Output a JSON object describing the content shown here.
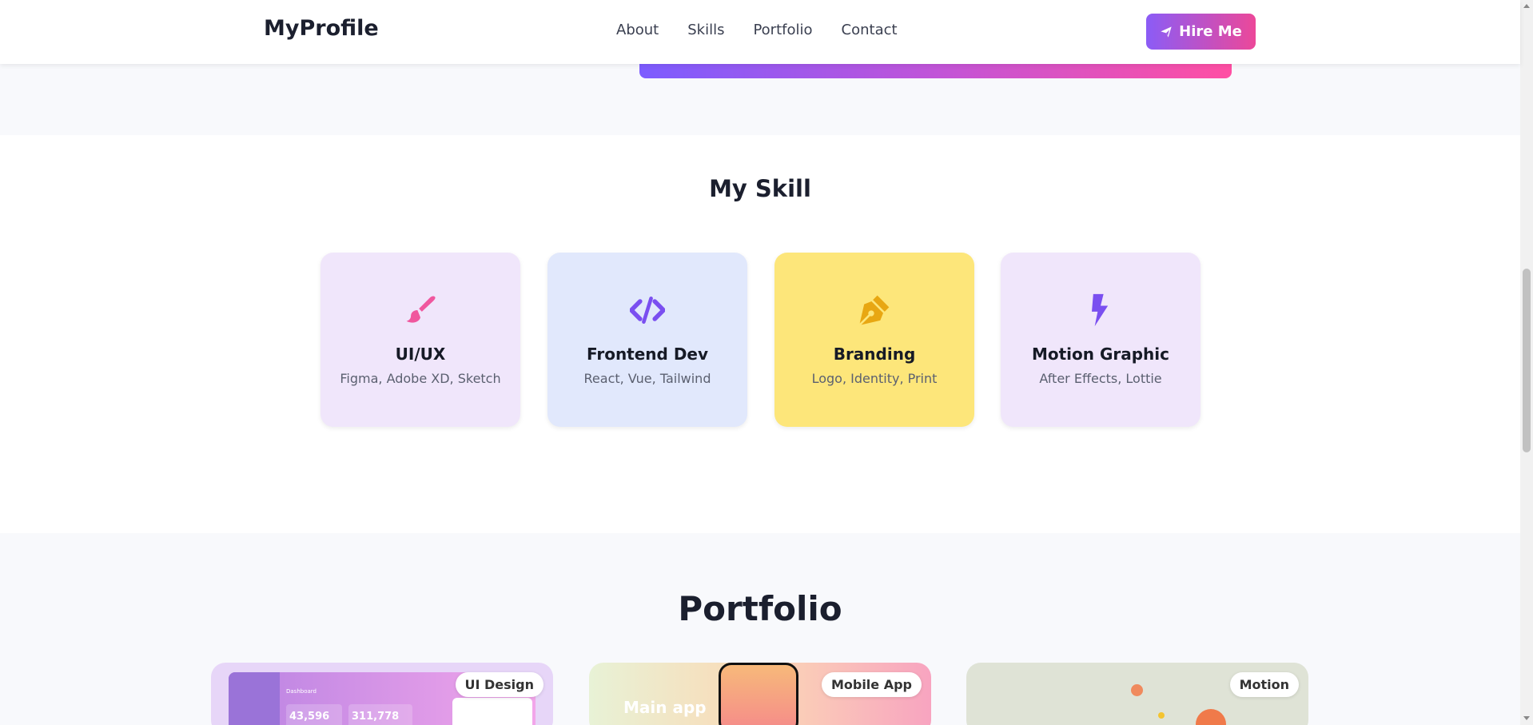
{
  "header": {
    "brand": "MyProfile",
    "nav": [
      "About",
      "Skills",
      "Portfolio",
      "Contact"
    ],
    "cta_label": "Hire Me",
    "cta_icon": "paper-plane-icon"
  },
  "skills": {
    "title": "My Skill",
    "cards": [
      {
        "title": "UI/UX",
        "desc": "Figma, Adobe XD, Sketch",
        "icon": "paintbrush-icon",
        "bg": "#f0e6fb",
        "icon_color": "#f0579e"
      },
      {
        "title": "Frontend Dev",
        "desc": "React, Vue, Tailwind",
        "icon": "code-icon",
        "bg": "#e1e8fc",
        "icon_color": "#7a4ff0"
      },
      {
        "title": "Branding",
        "desc": "Logo, Identity, Print",
        "icon": "pen-nib-icon",
        "bg": "#fde67a",
        "icon_color": "#e8a712"
      },
      {
        "title": "Motion Graphic",
        "desc": "After Effects, Lottie",
        "icon": "bolt-icon",
        "bg": "#f0e6fb",
        "icon_color": "#7a4ff0"
      }
    ]
  },
  "portfolio": {
    "title": "Portfolio",
    "items": [
      {
        "badge": "UI Design",
        "metrics": [
          "43,596",
          "311,778"
        ],
        "label": "Dashboard"
      },
      {
        "badge": "Mobile App",
        "text": "Main app"
      },
      {
        "badge": "Motion"
      }
    ]
  },
  "colors": {
    "accent_start": "#8b5cf6",
    "accent_end": "#ec4899"
  }
}
